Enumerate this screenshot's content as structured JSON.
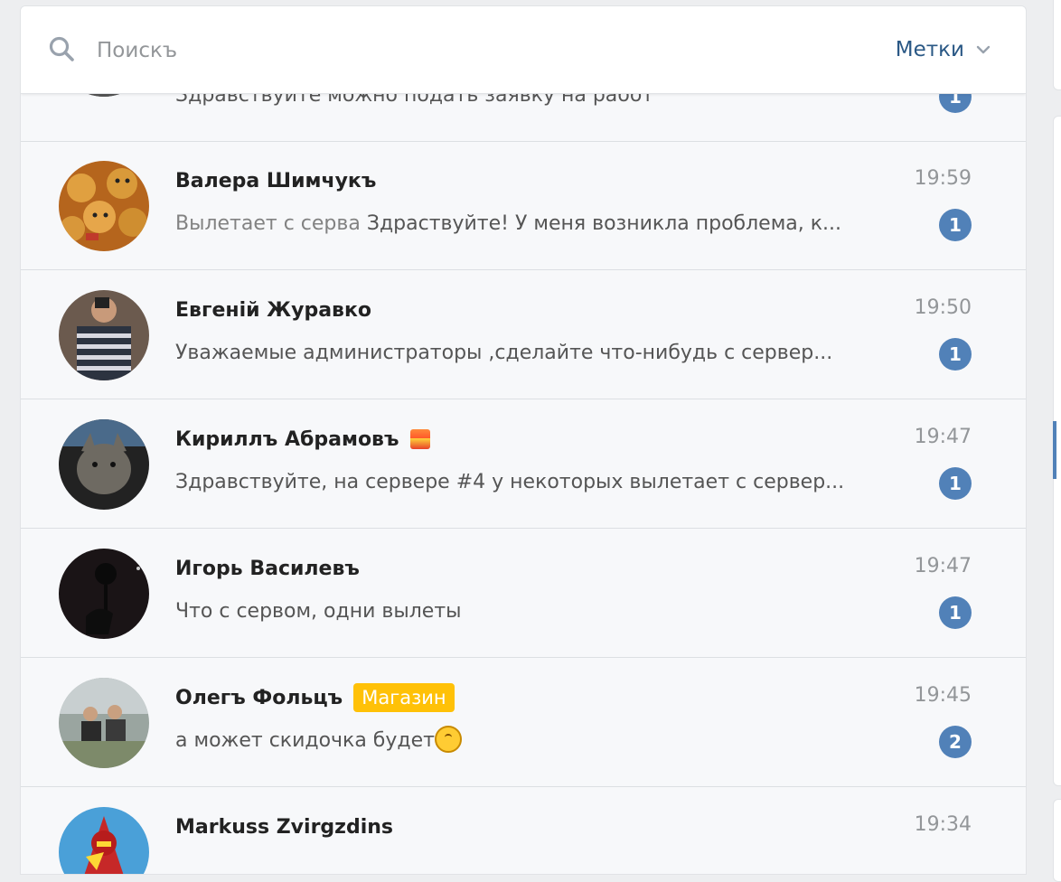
{
  "search": {
    "placeholder": "Поискъ",
    "labels_button": "Метки"
  },
  "colors": {
    "accent": "#5181b8",
    "link": "#2a5885",
    "tag_shop": "#ffc107"
  },
  "dialogs": [
    {
      "name": "",
      "time": "",
      "subject": "",
      "text": "Здравствуйте можно подать заявку на работ",
      "unread": "1"
    },
    {
      "name": "Валера Шимчукъ",
      "time": "19:59",
      "subject": "Вылетает с серва",
      "text": "Здраствуйте! У меня возникла проблема, к...",
      "unread": "1"
    },
    {
      "name": "Евгеній Журавко",
      "time": "19:50",
      "subject": "",
      "text": "Уважаемые администраторы ,сделайте что-нибудь с сервер...",
      "unread": "1"
    },
    {
      "name": "Кириллъ Абрамовъ",
      "time": "19:47",
      "subject": "",
      "text": "Здравствуйте, на сервере #4 у некоторых вылетает с сервер...",
      "unread": "1"
    },
    {
      "name": "Игорь Василевъ",
      "time": "19:47",
      "subject": "",
      "text": "Что с сервом, одни вылеты",
      "unread": "1"
    },
    {
      "name": "Олегъ Фольцъ",
      "tag": "Магазин",
      "time": "19:45",
      "subject": "",
      "text": "а может скидочка будет",
      "unread": "2"
    },
    {
      "name": "Markuss Zvirgzdins",
      "time": "19:34",
      "subject": "",
      "text": "",
      "unread": ""
    }
  ]
}
